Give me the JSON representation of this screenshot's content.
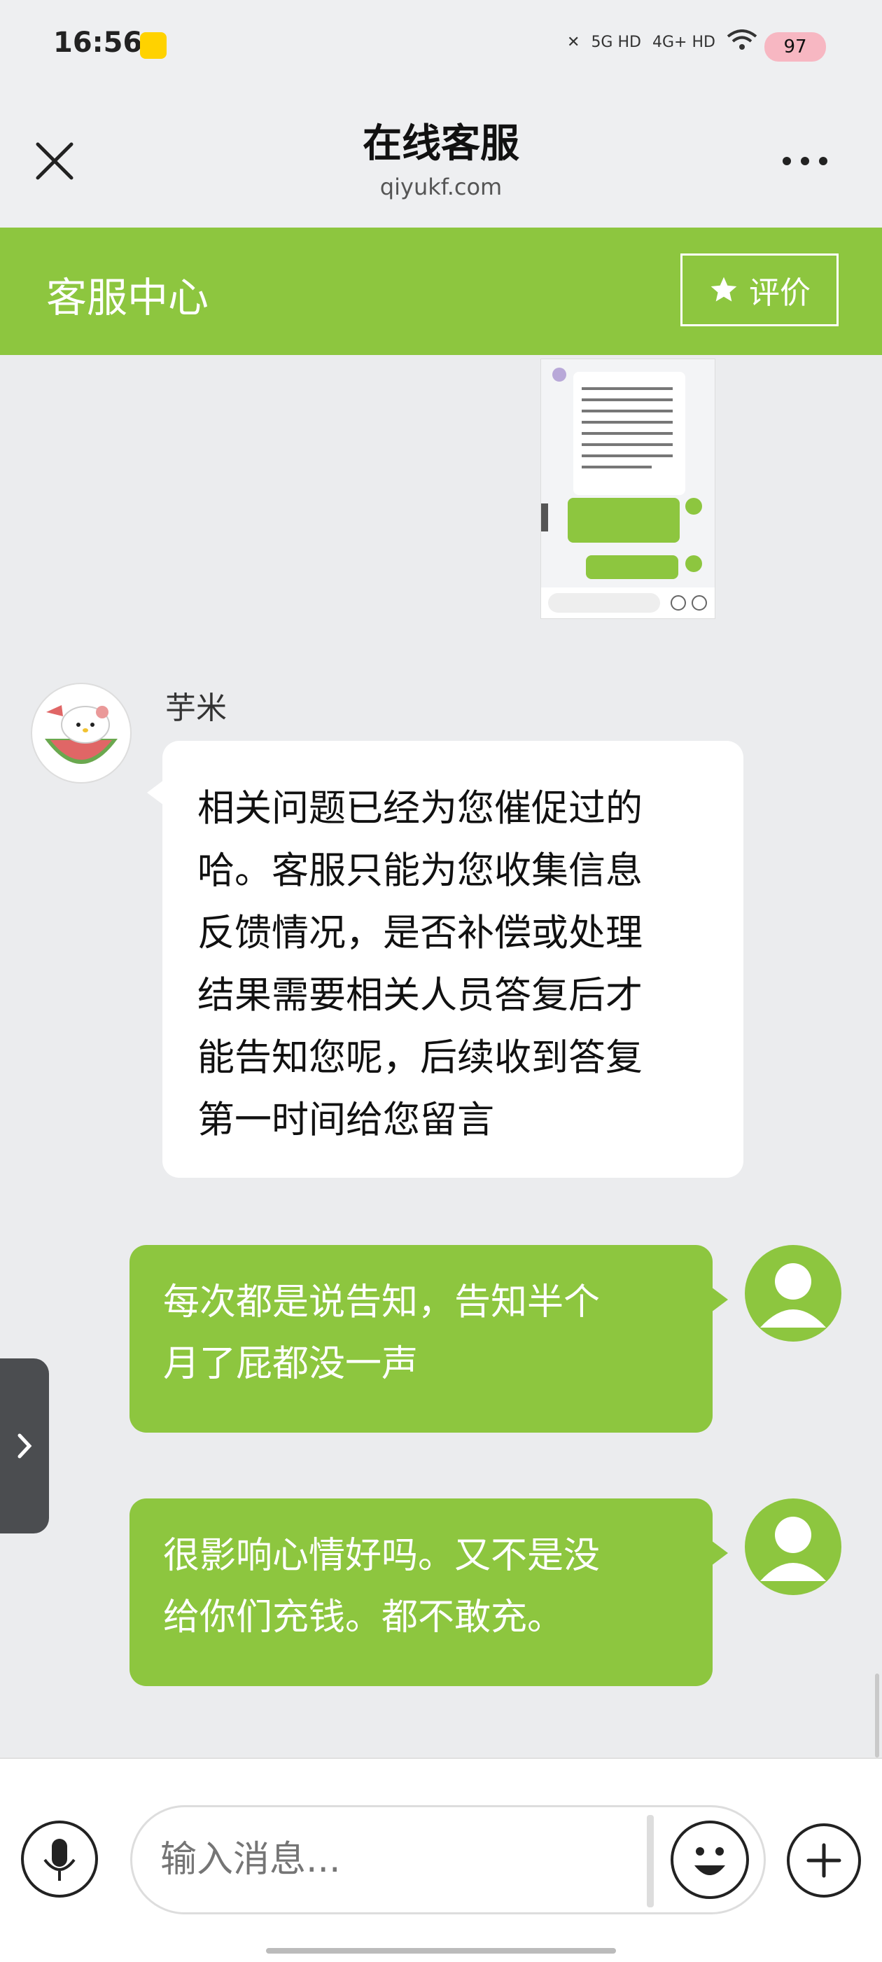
{
  "status_bar": {
    "time": "16:56",
    "network_1": "5G HD",
    "network_2": "4G+ HD",
    "battery": "97"
  },
  "title_bar": {
    "title": "在线客服",
    "subtitle": "qiyukf.com"
  },
  "header": {
    "title": "客服中心",
    "rate_label": "评价"
  },
  "messages": [
    {
      "sender": "芋米",
      "lines": [
        "相关问题已经为您催促过的",
        "哈。客服只能为您收集信息",
        "反馈情况，是否补偿或处理",
        "结果需要相关人员答复后才",
        "能告知您呢，后续收到答复",
        "第一时间给您留言"
      ]
    },
    {
      "lines": [
        "每次都是说告知，告知半个",
        "月了屁都没一声"
      ]
    },
    {
      "lines": [
        "很影响心情好吗。又不是没",
        "给你们充钱。都不敢充。"
      ]
    }
  ],
  "input": {
    "placeholder": "输入消息..."
  },
  "colors": {
    "accent": "#8dc63f",
    "background": "#ebecee"
  }
}
